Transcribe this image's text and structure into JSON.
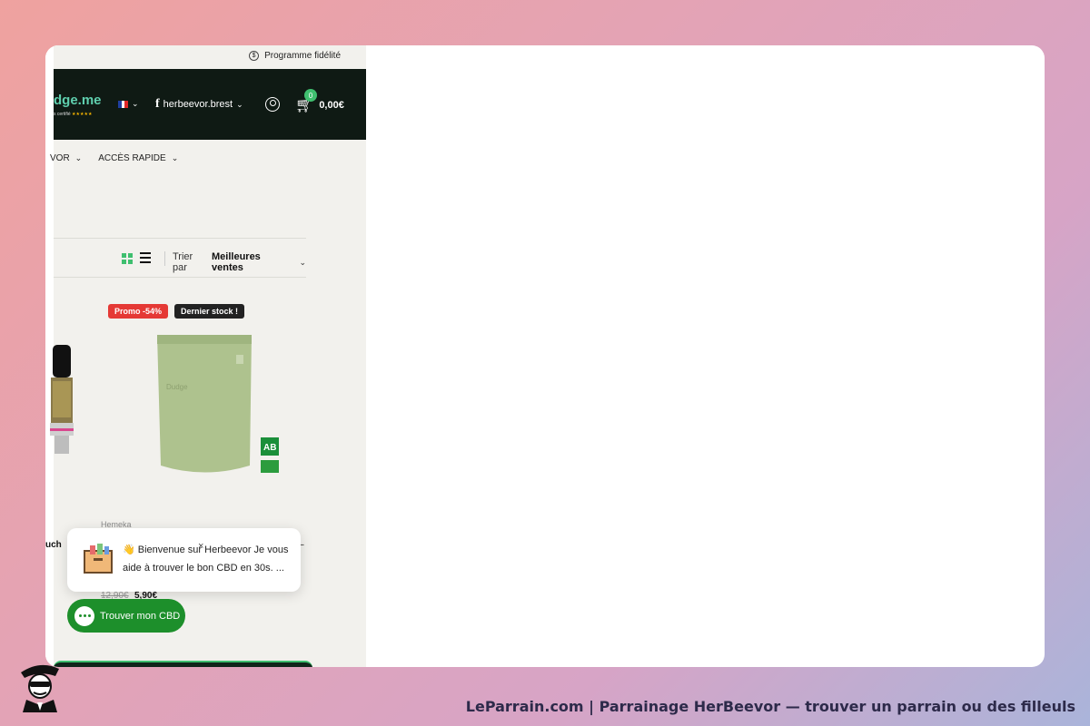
{
  "topbar": {
    "loyalty_label": "Programme fidélité",
    "loyalty_icon": "coin-icon"
  },
  "header": {
    "logo_text": "dge.me",
    "logo_sub": "s certifié",
    "logo_stars": "★★★★★",
    "facebook_label": "herbeevor.brest",
    "cart_count": "0",
    "cart_total": "0,00€"
  },
  "nav": {
    "items": [
      {
        "label": "VOR"
      },
      {
        "label": "ACCÈS RAPIDE"
      }
    ]
  },
  "toolbar": {
    "sort_label": "Trier par",
    "sort_value": "Meilleures ventes"
  },
  "product": {
    "promo_badge": "Promo -54%",
    "stock_badge": "Dernier stock !",
    "brand": "Hemeka",
    "left_title_fragment": "uch",
    "right_title_fragment": "–",
    "old_price": "12,90€",
    "new_price": "5,90€"
  },
  "chat": {
    "message": "👋 Bienvenue sur Herbeevor Je vous aide à trouver le bon CBD en 30s. ...",
    "close_glyph": "×",
    "button_label": "Trouver mon CBD"
  },
  "footer": {
    "caption": "LeParrain.com | Parrainage HerBeevor — trouver un parrain ou des filleuls"
  },
  "colors": {
    "accent": "#3fbf6f",
    "header_bg": "#0f1a14",
    "promo": "#e53935",
    "chat_button": "#1d8f2b"
  }
}
